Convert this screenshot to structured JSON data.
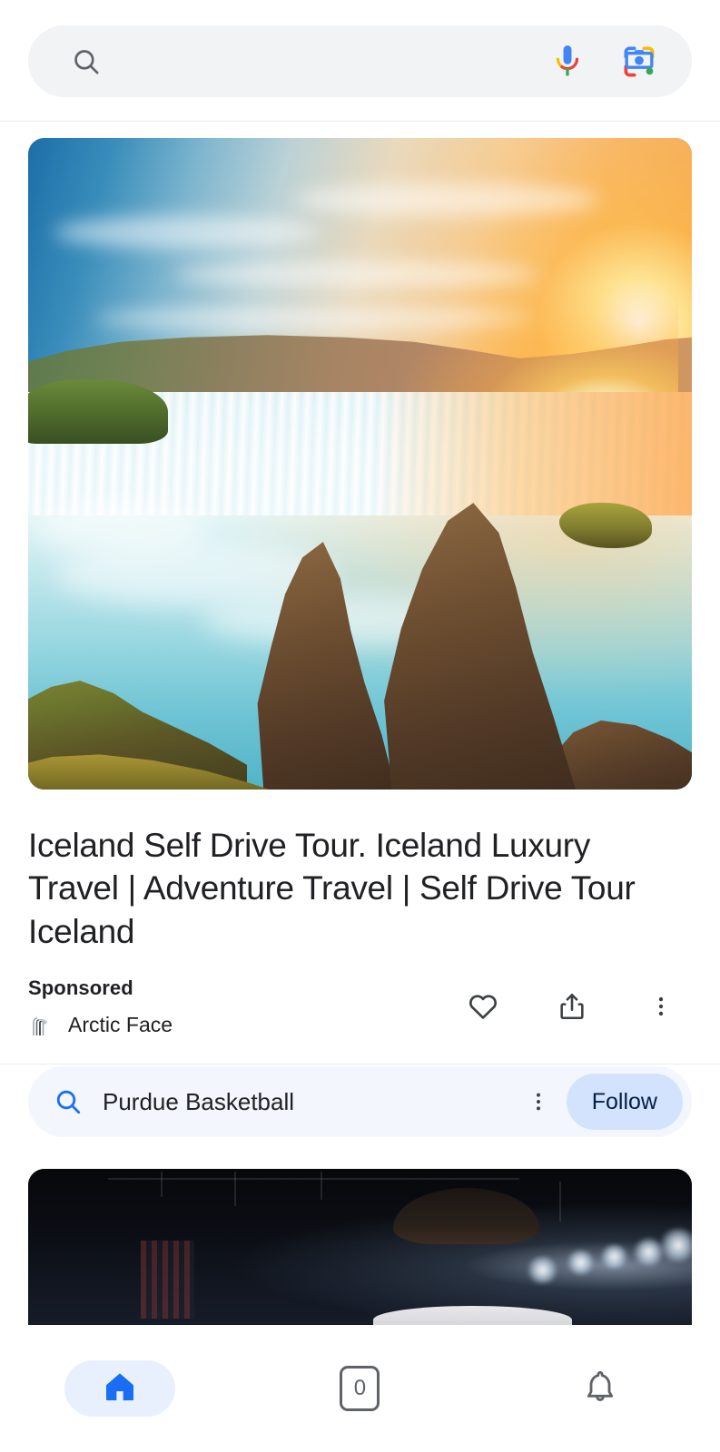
{
  "search": {
    "placeholder": "",
    "value": "",
    "search_icon": "search-icon",
    "mic_icon": "google-mic-icon",
    "lens_icon": "google-lens-icon"
  },
  "sponsored_card": {
    "image_alt": "Godafoss waterfall in Iceland at sunset with turquoise water and rocks",
    "title": "Iceland Self Drive Tour. Iceland Luxury Travel | Adventure Travel | Self Drive Tour Iceland",
    "sponsored_label": "Sponsored",
    "advertiser": "Arctic Face",
    "advertiser_logo": "arctic-face-logo-icon",
    "actions": [
      {
        "name": "favorite-button",
        "icon": "heart-icon"
      },
      {
        "name": "share-button",
        "icon": "share-icon"
      },
      {
        "name": "more-options-button",
        "icon": "three-dot-menu-icon"
      }
    ]
  },
  "topic": {
    "search_icon": "search-icon",
    "label": "Purdue Basketball",
    "menu_icon": "three-dot-menu-icon",
    "follow_label": "Follow"
  },
  "next_card": {
    "image_alt": "Basketball player in a dark arena with stadium lights"
  },
  "bottom_nav": {
    "items": [
      {
        "name": "nav-home",
        "icon": "home-icon",
        "selected": true
      },
      {
        "name": "nav-tabs",
        "icon": "tab-switcher-icon",
        "count": "0",
        "selected": false
      },
      {
        "name": "nav-notifications",
        "icon": "bell-icon",
        "selected": false
      }
    ]
  },
  "colors": {
    "accent_blue": "#1b6ef3",
    "chip_bg": "#f3f6fc",
    "follow_bg": "#d3e3fd",
    "search_bg": "#f1f3f4",
    "nav_pill_bg": "#e8f0fe",
    "text_primary": "#202124",
    "divider": "#e8eaed"
  }
}
